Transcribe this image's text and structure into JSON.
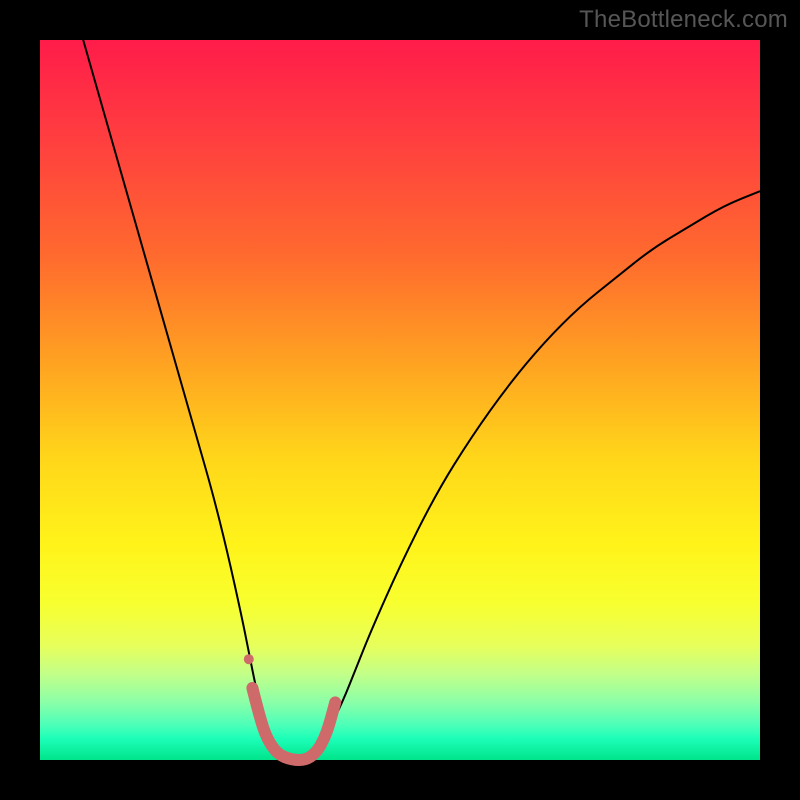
{
  "watermark": "TheBottleneck.com",
  "chart_data": {
    "type": "line",
    "title": "",
    "xlabel": "",
    "ylabel": "",
    "xlim": [
      0,
      100
    ],
    "ylim": [
      0,
      100
    ],
    "grid": false,
    "legend": false,
    "background_gradient": {
      "direction": "vertical",
      "stops": [
        {
          "pos": 0.0,
          "color": "#ff1c4a"
        },
        {
          "pos": 0.14,
          "color": "#ff3f3f"
        },
        {
          "pos": 0.3,
          "color": "#ff6a2e"
        },
        {
          "pos": 0.45,
          "color": "#ffa321"
        },
        {
          "pos": 0.58,
          "color": "#ffd61a"
        },
        {
          "pos": 0.7,
          "color": "#fff31a"
        },
        {
          "pos": 0.78,
          "color": "#f8ff2e"
        },
        {
          "pos": 0.84,
          "color": "#e8ff5a"
        },
        {
          "pos": 0.88,
          "color": "#c3ff88"
        },
        {
          "pos": 0.92,
          "color": "#8affa8"
        },
        {
          "pos": 0.95,
          "color": "#4fffb8"
        },
        {
          "pos": 0.97,
          "color": "#1dffb8"
        },
        {
          "pos": 1.0,
          "color": "#00e48b"
        }
      ]
    },
    "series": [
      {
        "name": "bottleneck-curve",
        "color": "#000000",
        "stroke_width": 2,
        "x": [
          6,
          8,
          10,
          12,
          14,
          16,
          18,
          20,
          22,
          24,
          26,
          28,
          29,
          30,
          31,
          32,
          33,
          34,
          35,
          36,
          37,
          38,
          40,
          42,
          44,
          46,
          50,
          55,
          60,
          65,
          70,
          75,
          80,
          85,
          90,
          95,
          100
        ],
        "y": [
          100,
          93,
          86,
          79,
          72,
          65,
          58,
          51,
          44,
          37,
          29,
          20,
          15,
          10,
          6,
          3,
          1,
          0,
          0,
          0,
          0,
          1,
          4,
          8,
          13,
          18,
          27,
          37,
          45,
          52,
          58,
          63,
          67,
          71,
          74,
          77,
          79
        ]
      },
      {
        "name": "valley-highlight",
        "color": "#cf6a6a",
        "stroke_width": 12,
        "linecap": "round",
        "x": [
          29.5,
          30.5,
          31.5,
          33.0,
          35.0,
          37.0,
          38.5,
          39.5,
          40.2,
          41.0
        ],
        "y": [
          10,
          6,
          3,
          0.8,
          0,
          0,
          1.2,
          3,
          5,
          8
        ]
      }
    ],
    "markers": [
      {
        "name": "valley-dot",
        "x": 29,
        "y": 14,
        "r": 5,
        "color": "#cf6a6a"
      }
    ]
  }
}
